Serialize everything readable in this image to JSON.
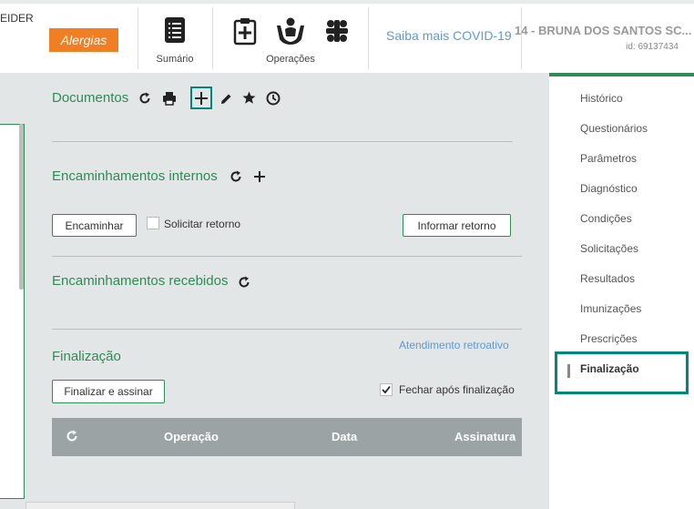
{
  "header": {
    "user_label": "EIDER",
    "allergy_badge": "Alergias",
    "summary_caption": "Sumário",
    "operations_caption": "Operações",
    "covid_link": "Saiba mais COVID-19",
    "patient_name": "14 - BRUNA DOS SANTOS SC...",
    "patient_id": "id: 69137434"
  },
  "documents": {
    "title": "Documentos"
  },
  "internal_referrals": {
    "title": "Encaminhamentos internos",
    "refer_button": "Encaminhar",
    "request_return_label": "Solicitar retorno",
    "inform_return_button": "Informar retorno"
  },
  "received_referrals": {
    "title": "Encaminhamentos recebidos"
  },
  "finalization": {
    "title": "Finalização",
    "retro_link": "Atendimento retroativo",
    "finalize_button": "Finalizar e assinar",
    "close_after_label": "Fechar após finalização",
    "close_after_checked": true,
    "table_headers": [
      "Operação",
      "Data",
      "Assinatura"
    ]
  },
  "sidebar": {
    "items": [
      {
        "label": "Histórico"
      },
      {
        "label": "Questionários"
      },
      {
        "label": "Parâmetros"
      },
      {
        "label": "Diagnóstico"
      },
      {
        "label": "Condições"
      },
      {
        "label": "Solicitações"
      },
      {
        "label": "Resultados"
      },
      {
        "label": "Imunizações"
      },
      {
        "label": "Prescrições"
      },
      {
        "label": "Finalização"
      }
    ],
    "active_index": 9
  },
  "colors": {
    "accent_green": "#2e8b57",
    "highlight_teal": "#00867a",
    "allergy_orange": "#f07f24",
    "link_blue": "#5b9bd5",
    "table_header_gray": "#9ca3a5"
  },
  "icons": {
    "summary": "list-icon",
    "operations": [
      "clipboard-plus-icon",
      "hands-care-icon",
      "team-icon"
    ],
    "documents_actions": [
      "refresh-icon",
      "print-icon",
      "plus-icon",
      "pencil-icon",
      "star-icon",
      "clock-icon"
    ]
  }
}
